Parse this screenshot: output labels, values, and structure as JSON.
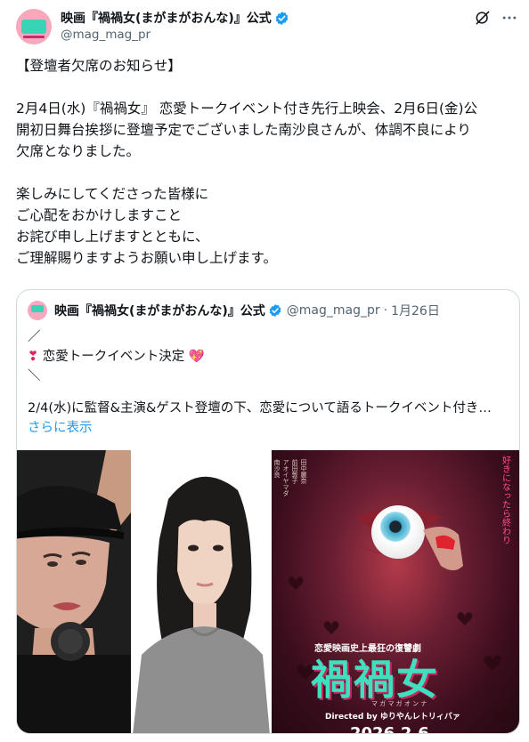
{
  "tweet": {
    "display_name": "映画『禍禍女(まがまがおんな)』公式",
    "handle": "@mag_mag_pr",
    "lines": [
      "【登壇者欠席のお知らせ】",
      "",
      "2月4日(水)『禍禍女』 恋愛トークイベント付き先行上映会、2月6日(金)公",
      "開初日舞台挨拶に登壇予定でございました南沙良さんが、体調不良により",
      "欠席となりました。",
      "",
      "楽しみにしてくださった皆様に",
      "ご心配をおかけしますこと",
      "お詫び申し上げますとともに、",
      "ご理解賜りますようお願い申し上げます。"
    ]
  },
  "quote": {
    "display_name": "映画『禍禍女(まがまがおんな)』公式",
    "handle": "@mag_mag_pr",
    "separator": "·",
    "date": "1月26日",
    "line1": "／",
    "line2_icon": "❣",
    "line2_text": "恋愛トークイベント決定",
    "line2_end": "💖",
    "line3": "＼",
    "line4": "2/4(水)に監督&主演&ゲスト登壇の下、恋愛について語るトークイベント付き…",
    "show_more": "さらに表示"
  },
  "poster": {
    "tagline": "恋愛映画史上最狂の復讐劇",
    "title": "禍禍女",
    "furigana": "マ ガ マ ガ オ ン ナ",
    "directed_by": "Directed by ゆりやんレトリィバァ",
    "date_partial": "2026.2.6"
  },
  "colors": {
    "accent": "#1d9bf0",
    "text": "#0f1419",
    "muted": "#536471",
    "border": "#cfd9de",
    "brand_pink": "#f7a8bd",
    "brand_mint": "#39d3b6"
  },
  "icons": {
    "verified": "verified-badge-icon",
    "grok": "grok-icon",
    "more": "more-options-icon"
  }
}
